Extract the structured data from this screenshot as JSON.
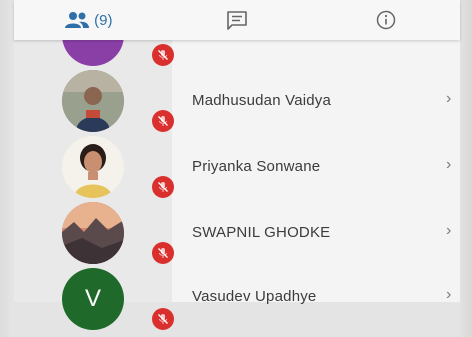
{
  "tabs": {
    "participants_count": "(9)"
  },
  "colors": {
    "accent": "#2f6fa8",
    "mute_badge": "#d9302e",
    "avatar_initial_bg": "#1f6a2b"
  },
  "participants": [
    {
      "name": "",
      "avatar": "purple-circle"
    },
    {
      "name": "Madhusudan Vaidya",
      "avatar": "photo"
    },
    {
      "name": "Priyanka Sonwane",
      "avatar": "photo"
    },
    {
      "name": "SWAPNIL GHODKE",
      "avatar": "photo"
    },
    {
      "name": "Vasudev Upadhye",
      "avatar": "initial",
      "initial": "V"
    }
  ]
}
